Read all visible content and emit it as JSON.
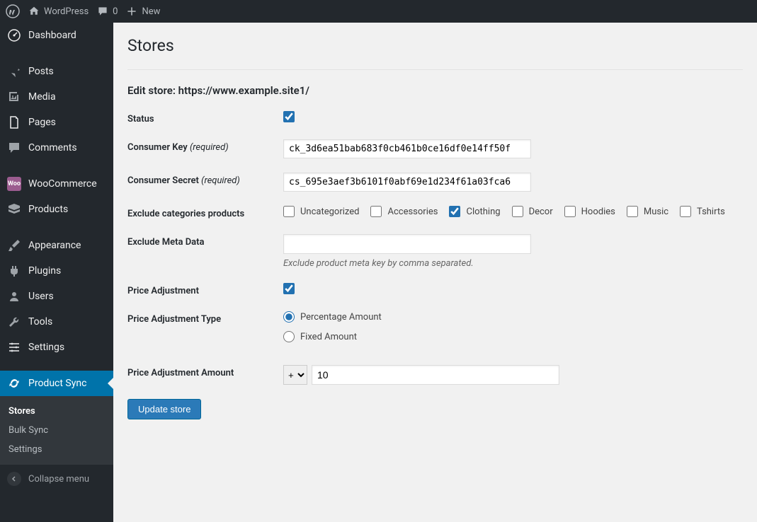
{
  "adminbar": {
    "site_name": "WordPress",
    "comments_count": "0",
    "new_label": "New"
  },
  "sidebar": {
    "items": [
      {
        "label": "Dashboard"
      },
      {
        "label": "Posts"
      },
      {
        "label": "Media"
      },
      {
        "label": "Pages"
      },
      {
        "label": "Comments"
      },
      {
        "label": "WooCommerce"
      },
      {
        "label": "Products"
      },
      {
        "label": "Appearance"
      },
      {
        "label": "Plugins"
      },
      {
        "label": "Users"
      },
      {
        "label": "Tools"
      },
      {
        "label": "Settings"
      },
      {
        "label": "Product Sync"
      }
    ],
    "submenu": [
      {
        "label": "Stores"
      },
      {
        "label": "Bulk Sync"
      },
      {
        "label": "Settings"
      }
    ],
    "collapse_label": "Collapse menu"
  },
  "page": {
    "title": "Stores",
    "subhead_prefix": "Edit store: ",
    "subhead_url": "https://www.example.site1/"
  },
  "form": {
    "status_label": "Status",
    "status_checked": true,
    "consumer_key_label": "Consumer Key",
    "consumer_key_value": "ck_3d6ea51bab683f0cb461b0ce16df0e14ff50f",
    "consumer_secret_label": "Consumer Secret",
    "consumer_secret_value": "cs_695e3aef3b6101f0abf69e1d234f61a03fca6",
    "required_text": "(required)",
    "exclude_cats_label": "Exclude categories products",
    "categories": [
      {
        "label": "Uncategorized",
        "checked": false
      },
      {
        "label": "Accessories",
        "checked": false
      },
      {
        "label": "Clothing",
        "checked": true
      },
      {
        "label": "Decor",
        "checked": false
      },
      {
        "label": "Hoodies",
        "checked": false
      },
      {
        "label": "Music",
        "checked": false
      },
      {
        "label": "Tshirts",
        "checked": false
      }
    ],
    "exclude_meta_label": "Exclude Meta Data",
    "exclude_meta_value": "",
    "exclude_meta_help": "Exclude product meta key by comma separated.",
    "price_adj_label": "Price Adjustment",
    "price_adj_checked": true,
    "price_adj_type_label": "Price Adjustment Type",
    "price_adj_type_options": [
      {
        "label": "Percentage Amount",
        "value": "percentage",
        "checked": true
      },
      {
        "label": "Fixed Amount",
        "value": "fixed",
        "checked": false
      }
    ],
    "price_adj_amount_label": "Price Adjustment Amount",
    "price_adj_amount_sign": "+",
    "price_adj_amount_value": "10",
    "submit_label": "Update store"
  }
}
